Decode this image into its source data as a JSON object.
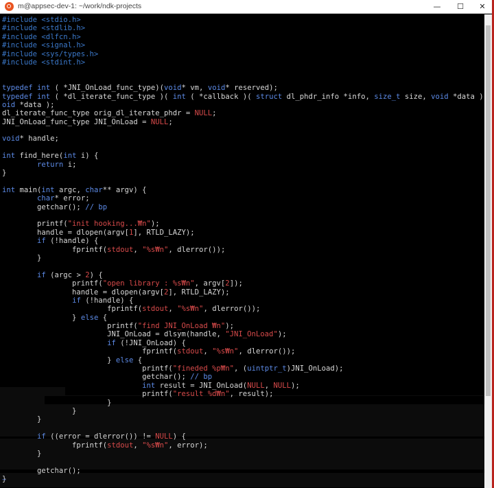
{
  "window": {
    "title": "m@appsec-dev-1: ~/work/ndk-projects",
    "minimize_glyph": "—",
    "maximize_glyph": "☐",
    "close_glyph": "✕",
    "icon": "ubuntu-logo-icon"
  },
  "colors": {
    "background": "#000000",
    "text": "#d8d8d8",
    "keyword": "#5c8ae6",
    "preprocessor": "#3b78c9",
    "string": "#d74a4a",
    "constant": "#d74a4a",
    "comment": "#5c8ae6"
  },
  "code": {
    "lines": [
      [
        {
          "t": "#include <stdio.h>",
          "c": "p"
        }
      ],
      [
        {
          "t": "#include <stdlib.h>",
          "c": "p"
        }
      ],
      [
        {
          "t": "#include <dlfcn.h>",
          "c": "p"
        }
      ],
      [
        {
          "t": "#include <signal.h>",
          "c": "p"
        }
      ],
      [
        {
          "t": "#include <sys/types.h>",
          "c": "p"
        }
      ],
      [
        {
          "t": "#include <stdint.h>",
          "c": "p"
        }
      ],
      [],
      [],
      [
        {
          "t": "typedef",
          "c": "k"
        },
        {
          "t": " "
        },
        {
          "t": "int",
          "c": "k"
        },
        {
          "t": " ( *JNI_OnLoad_func_type)("
        },
        {
          "t": "void",
          "c": "k"
        },
        {
          "t": "* vm, "
        },
        {
          "t": "void",
          "c": "k"
        },
        {
          "t": "* reserved);"
        }
      ],
      [
        {
          "t": "typedef",
          "c": "k"
        },
        {
          "t": " "
        },
        {
          "t": "int",
          "c": "k"
        },
        {
          "t": " ( *dl_iterate_func_type )( "
        },
        {
          "t": "int",
          "c": "k"
        },
        {
          "t": " ( *callback )( "
        },
        {
          "t": "struct",
          "c": "k"
        },
        {
          "t": " dl_phdr_info *info, "
        },
        {
          "t": "size_t",
          "c": "k"
        },
        {
          "t": " size, "
        },
        {
          "t": "void",
          "c": "k"
        },
        {
          "t": " *data ), "
        },
        {
          "t": "v",
          "c": "k"
        }
      ],
      [
        {
          "t": "oid",
          "c": "k"
        },
        {
          "t": " *data );"
        }
      ],
      [
        {
          "t": "dl_iterate_func_type orig_dl_iterate_phdr = "
        },
        {
          "t": "NULL",
          "c": "n"
        },
        {
          "t": ";"
        }
      ],
      [
        {
          "t": "JNI_OnLoad_func_type JNI_OnLoad = "
        },
        {
          "t": "NULL",
          "c": "n"
        },
        {
          "t": ";"
        }
      ],
      [],
      [
        {
          "t": "void",
          "c": "k"
        },
        {
          "t": "* handle;"
        }
      ],
      [],
      [
        {
          "t": "int",
          "c": "k"
        },
        {
          "t": " find_here("
        },
        {
          "t": "int",
          "c": "k"
        },
        {
          "t": " i) {"
        }
      ],
      [
        {
          "t": "        "
        },
        {
          "t": "return",
          "c": "k"
        },
        {
          "t": " i;"
        }
      ],
      [
        {
          "t": "}"
        }
      ],
      [],
      [
        {
          "t": "int",
          "c": "k"
        },
        {
          "t": " main("
        },
        {
          "t": "int",
          "c": "k"
        },
        {
          "t": " argc, "
        },
        {
          "t": "char",
          "c": "k"
        },
        {
          "t": "** argv) {"
        }
      ],
      [
        {
          "t": "        "
        },
        {
          "t": "char",
          "c": "k"
        },
        {
          "t": "* error;"
        }
      ],
      [
        {
          "t": "        getchar(); "
        },
        {
          "t": "// bp",
          "c": "c"
        }
      ],
      [],
      [
        {
          "t": "        printf("
        },
        {
          "t": "\"init hooking...₩n\"",
          "c": "s"
        },
        {
          "t": ");"
        }
      ],
      [
        {
          "t": "        handle = dlopen(argv["
        },
        {
          "t": "1",
          "c": "n"
        },
        {
          "t": "], RTLD_LAZY);"
        }
      ],
      [
        {
          "t": "        "
        },
        {
          "t": "if",
          "c": "k"
        },
        {
          "t": " (!handle) {"
        }
      ],
      [
        {
          "t": "                fprintf("
        },
        {
          "t": "stdout",
          "c": "s"
        },
        {
          "t": ", "
        },
        {
          "t": "\"%s₩n\"",
          "c": "s"
        },
        {
          "t": ", dlerror());"
        }
      ],
      [
        {
          "t": "        }"
        }
      ],
      [],
      [
        {
          "t": "        "
        },
        {
          "t": "if",
          "c": "k"
        },
        {
          "t": " (argc > "
        },
        {
          "t": "2",
          "c": "n"
        },
        {
          "t": ") {"
        }
      ],
      [
        {
          "t": "                printf("
        },
        {
          "t": "\"open library : %s₩n\"",
          "c": "s"
        },
        {
          "t": ", argv["
        },
        {
          "t": "2",
          "c": "n"
        },
        {
          "t": "]);"
        }
      ],
      [
        {
          "t": "                handle = dlopen(argv["
        },
        {
          "t": "2",
          "c": "n"
        },
        {
          "t": "], RTLD_LAZY);"
        }
      ],
      [
        {
          "t": "                "
        },
        {
          "t": "if",
          "c": "k"
        },
        {
          "t": " (!handle) {"
        }
      ],
      [
        {
          "t": "                        fprintf("
        },
        {
          "t": "stdout",
          "c": "s"
        },
        {
          "t": ", "
        },
        {
          "t": "\"%s₩n\"",
          "c": "s"
        },
        {
          "t": ", dlerror());"
        }
      ],
      [
        {
          "t": "                } "
        },
        {
          "t": "else",
          "c": "k"
        },
        {
          "t": " {"
        }
      ],
      [
        {
          "t": "                        printf("
        },
        {
          "t": "\"find JNI_OnLoad ₩n\"",
          "c": "s"
        },
        {
          "t": ");"
        }
      ],
      [
        {
          "t": "                        JNI_OnLoad = dlsym(handle, "
        },
        {
          "t": "\"JNI_OnLoad\"",
          "c": "s"
        },
        {
          "t": ");"
        }
      ],
      [
        {
          "t": "                        "
        },
        {
          "t": "if",
          "c": "k"
        },
        {
          "t": " (!JNI_OnLoad) {"
        }
      ],
      [
        {
          "t": "                                fprintf("
        },
        {
          "t": "stdout",
          "c": "s"
        },
        {
          "t": ", "
        },
        {
          "t": "\"%s₩n\"",
          "c": "s"
        },
        {
          "t": ", dlerror());"
        }
      ],
      [
        {
          "t": "                        } "
        },
        {
          "t": "else",
          "c": "k"
        },
        {
          "t": " {"
        }
      ],
      [
        {
          "t": "                                printf("
        },
        {
          "t": "\"fineded %p₩n\"",
          "c": "s"
        },
        {
          "t": ", ("
        },
        {
          "t": "uintptr_t",
          "c": "k"
        },
        {
          "t": ")JNI_OnLoad);"
        }
      ],
      [
        {
          "t": "                                getchar(); "
        },
        {
          "t": "// bp",
          "c": "c"
        }
      ],
      [
        {
          "t": "                                "
        },
        {
          "t": "int",
          "c": "k"
        },
        {
          "t": " result = JNI_OnLoad("
        },
        {
          "t": "NULL",
          "c": "n"
        },
        {
          "t": ", "
        },
        {
          "t": "NULL",
          "c": "n"
        },
        {
          "t": ");"
        }
      ],
      [
        {
          "t": "                                printf("
        },
        {
          "t": "\"result %d₩n\"",
          "c": "s"
        },
        {
          "t": ", result);"
        }
      ],
      [
        {
          "t": "                        }"
        }
      ],
      [
        {
          "t": "                }"
        }
      ],
      [
        {
          "t": "        }"
        }
      ],
      [],
      [
        {
          "t": "        "
        },
        {
          "t": "if",
          "c": "k"
        },
        {
          "t": " ((error = dlerror()) != "
        },
        {
          "t": "NULL",
          "c": "n"
        },
        {
          "t": ") {"
        }
      ],
      [
        {
          "t": "                fprintf("
        },
        {
          "t": "stdout",
          "c": "s"
        },
        {
          "t": ", "
        },
        {
          "t": "\"%s₩n\"",
          "c": "s"
        },
        {
          "t": ", error);"
        }
      ],
      [
        {
          "t": "        }"
        }
      ],
      [],
      [
        {
          "t": "        getchar();"
        }
      ],
      [
        {
          "t": "}"
        }
      ]
    ],
    "end_marker": "~"
  }
}
